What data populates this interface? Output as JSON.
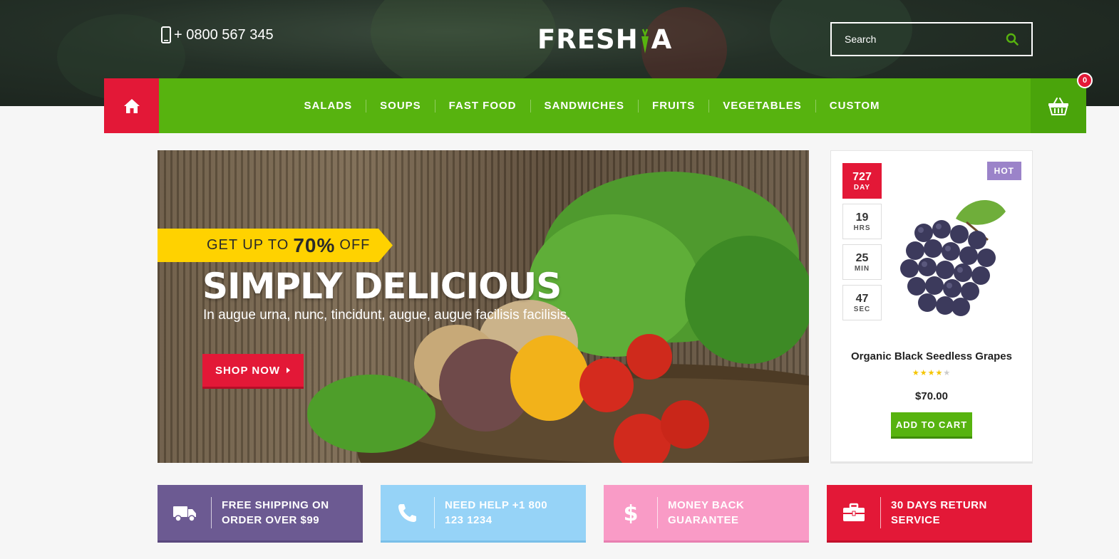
{
  "header": {
    "phone": "+ 0800 567 345",
    "logo_left": "FRESH",
    "logo_right": "A",
    "search_placeholder": "Search"
  },
  "nav": {
    "items": [
      {
        "label": "SALADS"
      },
      {
        "label": "SOUPS"
      },
      {
        "label": "FAST FOOD"
      },
      {
        "label": "SANDWICHES"
      },
      {
        "label": "FRUITS"
      },
      {
        "label": "VEGETABLES"
      },
      {
        "label": "CUSTOM"
      }
    ],
    "cart_count": "0"
  },
  "hero": {
    "promo_pre": "GET UP TO",
    "promo_value": "70%",
    "promo_post": "OFF",
    "title": "SIMPLY DELICIOUS",
    "subtitle": "In augue urna, nunc, tincidunt, augue, augue facilisis facilisis.",
    "button": "SHOP NOW"
  },
  "deal": {
    "badge": "HOT",
    "countdown": [
      {
        "value": "727",
        "unit": "DAY"
      },
      {
        "value": "19",
        "unit": "HRS"
      },
      {
        "value": "25",
        "unit": "MIN"
      },
      {
        "value": "47",
        "unit": "SEC"
      }
    ],
    "product_name": "Organic Black Seedless Grapes",
    "rating": 4,
    "rating_max": 5,
    "price": "$70.00",
    "button": "ADD TO CART"
  },
  "features": [
    {
      "line1": "FREE SHIPPING ON",
      "line2": "ORDER OVER $99",
      "icon": "truck-icon"
    },
    {
      "line1": "NEED HELP +1 800",
      "line2": "123 1234",
      "icon": "phone-icon"
    },
    {
      "line1": "MONEY BACK",
      "line2": "GUARANTEE",
      "icon": "dollar-icon"
    },
    {
      "line1": "30 DAYS RETURN",
      "line2": "SERVICE",
      "icon": "briefcase-icon"
    }
  ],
  "colors": {
    "green": "#57b30f",
    "red": "#e31837",
    "yellow": "#ffd200",
    "purple": "#6c5a92",
    "light_blue": "#96d3f7",
    "pink": "#f99bc6"
  }
}
